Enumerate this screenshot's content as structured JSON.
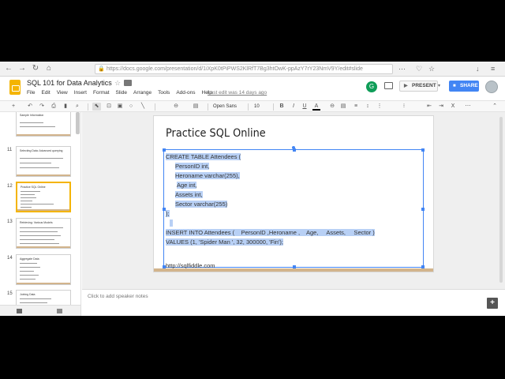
{
  "browser": {
    "url": "https://docs.google.com/presentation/d/1iXpK0tPiPWS2KlRfT7Bg3htOwK-ppAzY7rY23NmV9Y/edit#slide",
    "back_glyph": "←",
    "forward_glyph": "→",
    "reload_glyph": "↻",
    "home_glyph": "⌂",
    "lock_glyph": "🔒",
    "right_glyphs": [
      "⋯",
      "♡",
      "☆",
      "↓",
      "≡"
    ]
  },
  "doc": {
    "title": "SQL 101 for Data Analytics",
    "star_glyph": "☆",
    "last_edit": "Last edit was 14 days ago",
    "user_initial": "G",
    "present_label": "PRESENT",
    "present_caret": "▾",
    "share_label": "SHARE"
  },
  "menu": [
    "File",
    "Edit",
    "View",
    "Insert",
    "Format",
    "Slide",
    "Arrange",
    "Tools",
    "Add-ons",
    "Help"
  ],
  "toolbar": {
    "font": "Open Sans",
    "font_size": "10",
    "bold": "B",
    "italic": "I",
    "underline": "U",
    "text_color": "A",
    "icons": {
      "add": "+",
      "undo": "↶",
      "redo": "↷",
      "print": "⎙",
      "paint_format": "▮",
      "zoom": "⌕",
      "select": "⬉",
      "text_box": "⊡",
      "image": "▣",
      "shape": "○",
      "line": "╲",
      "link": "⊖",
      "comment": "▤",
      "align": "≡",
      "line_spacing": "↕",
      "numbered_list": "⋮",
      "bulleted_list": "⁝",
      "decrease_indent": "⇤",
      "increase_indent": "⇥",
      "clear_format": "Ⅹ",
      "more": "⋯",
      "collapse": "⌃"
    }
  },
  "filmstrip": {
    "slides": [
      {
        "number": "",
        "title": "Sample Information"
      },
      {
        "number": "11",
        "title": "Selecting Data: Advanced querying"
      },
      {
        "number": "12",
        "title": "Practice SQL Online"
      },
      {
        "number": "13",
        "title": "Retrieving: Various Models"
      },
      {
        "number": "14",
        "title": "Aggregate Data"
      },
      {
        "number": "15",
        "title": "Joining Data"
      }
    ]
  },
  "slide": {
    "title": "Practice SQL Online",
    "code": [
      "CREATE TABLE Attendees (",
      "PersonID int,",
      "Heroname varchar(255),",
      "Age int,",
      "Assets int,",
      "Sector varchar(255)",
      ");",
      "",
      "INSERT INTO Attendees (    PersonID ,Heroname ,    Age,     Assets,     Sector )",
      "VALUES (1, 'Spider Man ', 32, 300000, 'Fin');"
    ],
    "link": "http://sqlfiddle.com"
  },
  "notes": {
    "placeholder": "Click to add speaker notes",
    "add_glyph": "+"
  },
  "colors": {
    "accent_blue": "#4285f4",
    "slides_yellow": "#f4b400",
    "selection_highlight": "#b8d0f5",
    "slide_bar": "#d2b48c"
  }
}
